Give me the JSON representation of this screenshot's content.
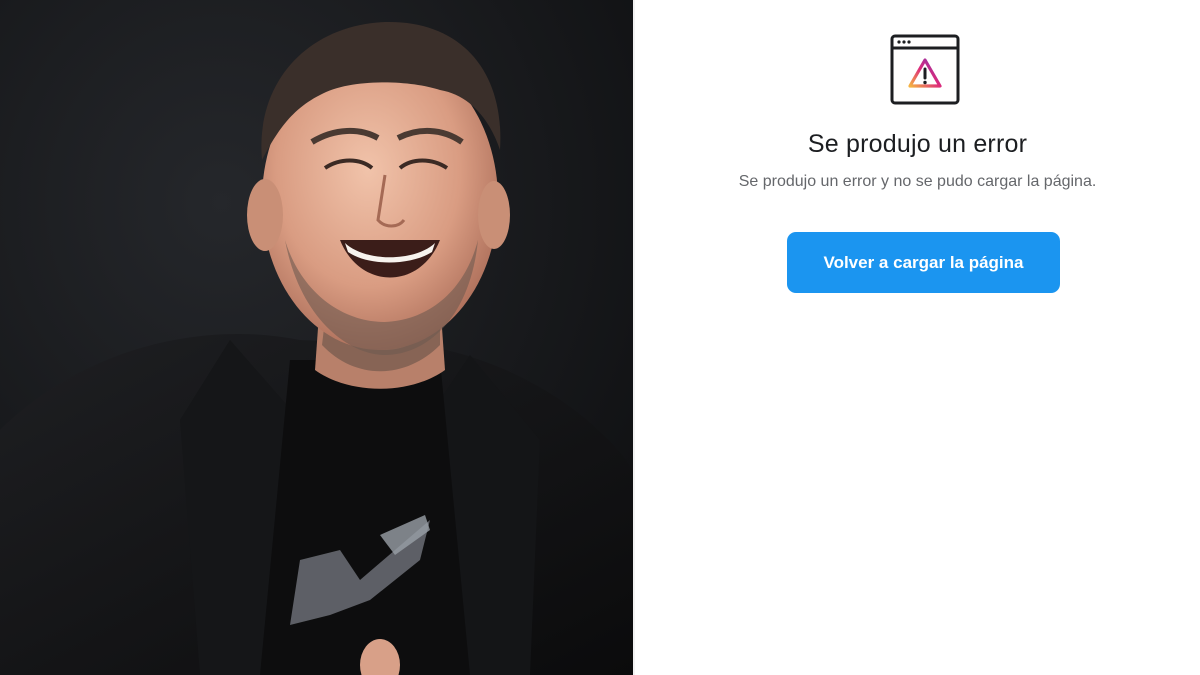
{
  "photo": {
    "icon": "person-photo"
  },
  "error": {
    "icon": "browser-warning-icon",
    "title": "Se produjo un error",
    "subtitle": "Se produjo un error y no se pudo cargar la página.",
    "reload_button_label": "Volver a cargar la página"
  },
  "colors": {
    "button_bg": "#1b95f0",
    "button_text": "#ffffff",
    "title_text": "#1c1e21",
    "subtitle_text": "#65676b",
    "warning_gradient_start": "#f58529",
    "warning_gradient_mid": "#dd2a7b",
    "warning_gradient_end": "#8134af"
  }
}
